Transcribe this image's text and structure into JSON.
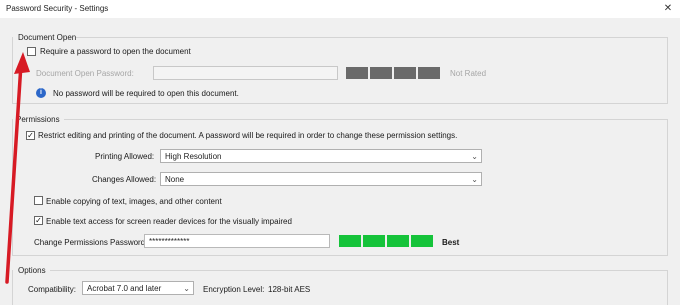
{
  "window": {
    "title": "Password Security - Settings",
    "close_glyph": "✕"
  },
  "document_open": {
    "section_label": "Document Open",
    "require_password_label": "Require a password to open the document",
    "require_password_checked": false,
    "password_label": "Document Open Password:",
    "password_value": "",
    "strength_text": "Not Rated",
    "info_icon": "info-icon",
    "info_text": "No password will be required to open this document."
  },
  "permissions": {
    "section_label": "Permissions",
    "restrict_label": "Restrict editing and printing of the document. A password will be required in order to change these permission settings.",
    "restrict_checked": true,
    "printing_label": "Printing Allowed:",
    "printing_value": "High Resolution",
    "changes_label": "Changes Allowed:",
    "changes_value": "None",
    "enable_copy_label": "Enable copying of text, images, and other content",
    "enable_copy_checked": false,
    "enable_access_label": "Enable text access for screen reader devices for the visually impaired",
    "enable_access_checked": true,
    "perm_password_label": "Change Permissions Password:",
    "perm_password_value": "*************",
    "perm_strength_text": "Best"
  },
  "options": {
    "section_label": "Options",
    "compat_label": "Compatibility:",
    "compat_value": "Acrobat 7.0 and later",
    "encryption_label": "Encryption  Level:",
    "encryption_value": "128-bit AES"
  },
  "colors": {
    "arrow": "#d71a24",
    "strength_best": "#15c33a",
    "strength_unrated": "#6a6a6a",
    "info_icon": "#2c67c9"
  }
}
